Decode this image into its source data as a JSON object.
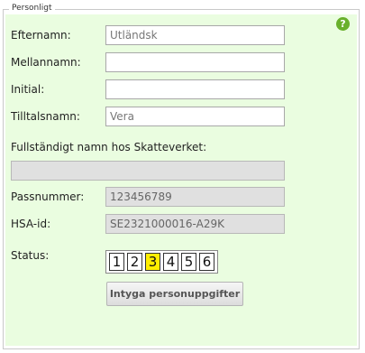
{
  "section": {
    "legend": "Personligt",
    "help_icon": "?"
  },
  "fields": {
    "efternamn": {
      "label": "Efternamn:",
      "value": "Utländsk"
    },
    "mellannamn": {
      "label": "Mellannamn:",
      "value": ""
    },
    "initial": {
      "label": "Initial:",
      "value": ""
    },
    "tilltalsnamn": {
      "label": "Tilltalsnamn:",
      "value": "Vera"
    },
    "fullstandigt": {
      "label": "Fullständigt namn hos Skatteverket:",
      "value": ""
    },
    "passnummer": {
      "label": "Passnummer:",
      "value": "123456789"
    },
    "hsa_id": {
      "label": "HSA-id:",
      "value": "SE2321000016-A29K"
    }
  },
  "status": {
    "label": "Status:",
    "options": [
      "1",
      "2",
      "3",
      "4",
      "5",
      "6"
    ],
    "selected": "3",
    "highlight_color": "#ffee00"
  },
  "actions": {
    "verify_label": "Intyga personuppgifter"
  }
}
